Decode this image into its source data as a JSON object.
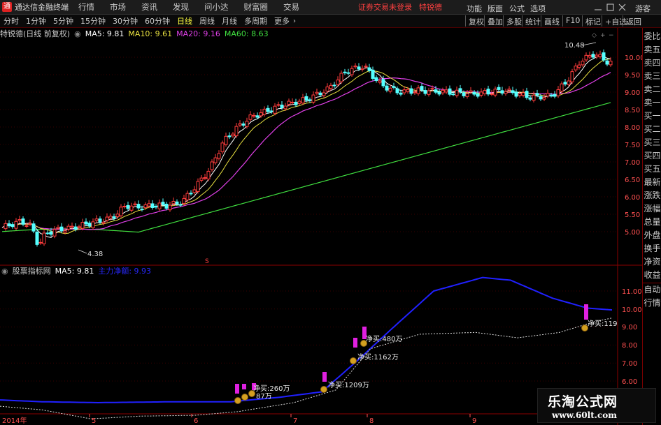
{
  "app": {
    "title": "通达信金融终端",
    "menus": [
      "行情",
      "市场",
      "资讯",
      "发现",
      "问小达",
      "财富圈",
      "交易"
    ],
    "login_warning": "证券交易未登录",
    "stock_name": "特锐德",
    "right_menus": [
      "功能",
      "版面",
      "公式",
      "选项",
      "游客"
    ]
  },
  "toolbar": {
    "periods": [
      "分时",
      "1分钟",
      "5分钟",
      "15分钟",
      "30分钟",
      "60分钟",
      "日线",
      "周线",
      "月线",
      "多周期",
      "更多"
    ],
    "active_period": "日线",
    "buttons": [
      "复权",
      "叠加",
      "多股",
      "统计",
      "画线",
      "F10",
      "标记",
      "+自选",
      "返回"
    ]
  },
  "main_chart": {
    "name": "特锐德(日线 前复权)",
    "ma5_label": "MA5: 9.81",
    "ma10_label": "MA10: 9.61",
    "ma20_label": "MA20: 9.16",
    "ma60_label": "MA60: 8.63",
    "high_label": "10.48",
    "low_label": "4.38",
    "y_ticks": [
      "10.00",
      "9.50",
      "9.00",
      "8.50",
      "8.00",
      "7.50",
      "7.00",
      "6.50",
      "6.00",
      "5.50",
      "5.00"
    ],
    "marker": "S"
  },
  "indicator_chart": {
    "name": "股票指标网",
    "ma5_label": "MA5: 9.81",
    "main_fund_label": "主力净额: 9.93",
    "y_ticks": [
      "11.00",
      "10.00",
      "9.00",
      "8.00",
      "7.00",
      "6.00"
    ],
    "annotations": [
      {
        "text": "净买:260万"
      },
      {
        "text": "87万"
      },
      {
        "text": "净买:1209万"
      },
      {
        "text": "净买:1162万"
      },
      {
        "text": "净买:480万"
      },
      {
        "text": "净买:119"
      }
    ]
  },
  "x_axis": [
    "2014年",
    "5",
    "6",
    "7",
    "8",
    "9"
  ],
  "side_panel": [
    "委比",
    "卖五",
    "卖四",
    "卖三",
    "卖二",
    "卖一",
    "买一",
    "买二",
    "买三",
    "买四",
    "买五",
    "最新",
    "涨跌",
    "涨幅",
    "总量",
    "外盘",
    "换手",
    "净资",
    "收益"
  ],
  "side_panel_bottom": [
    "自动",
    "行情"
  ],
  "watermark": {
    "title": "乐淘公式网",
    "url": "www.60lt.com"
  },
  "colors": {
    "up": "#ff3c3c",
    "down": "#54ffff",
    "ma5": "#ffffff",
    "ma10": "#e8e040",
    "ma20": "#e040e8",
    "ma60": "#40e040",
    "fund": "#2020ff"
  }
}
